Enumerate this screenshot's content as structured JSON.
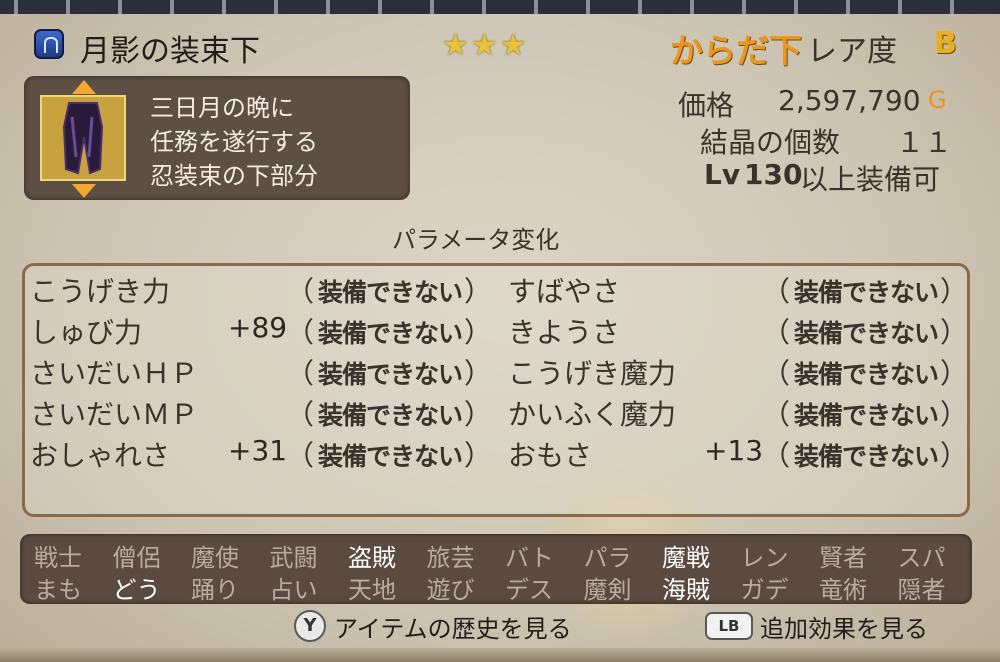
{
  "header": {
    "item_name": "月影の装束下",
    "stars": "★★★",
    "slot": "からだ下",
    "rarity_label": "レア度",
    "rarity": "B"
  },
  "description": [
    "三日月の晩に",
    "任務を遂行する",
    "忍装束の下部分"
  ],
  "stats_right": {
    "price_label": "価格",
    "price": "2,597,790",
    "price_unit": "G",
    "crystal_label": "結晶の個数",
    "crystal_count": "１１",
    "lv_prefix": "Lv",
    "lv_value": "130",
    "lv_suffix": "以上装備可"
  },
  "params_title": "パラメータ変化",
  "params_left": [
    {
      "label": "こうげき力",
      "value": "",
      "status": "装備できない"
    },
    {
      "label": "しゅび力",
      "value": "+89",
      "status": "装備できない"
    },
    {
      "label": "さいだいＨＰ",
      "value": "",
      "status": "装備できない"
    },
    {
      "label": "さいだいＭＰ",
      "value": "",
      "status": "装備できない"
    },
    {
      "label": "おしゃれさ",
      "value": "+31",
      "status": "装備できない"
    }
  ],
  "params_right": [
    {
      "label": "すばやさ",
      "value": "",
      "status": "装備できない"
    },
    {
      "label": "きようさ",
      "value": "",
      "status": "装備できない"
    },
    {
      "label": "こうげき魔力",
      "value": "",
      "status": "装備できない"
    },
    {
      "label": "かいふく魔力",
      "value": "",
      "status": "装備できない"
    },
    {
      "label": "おもさ",
      "value": "+13",
      "status": "装備できない"
    }
  ],
  "paren_open": "（",
  "paren_close": "）",
  "jobs_row1": [
    "戦士",
    "僧侶",
    "魔使",
    "武闘",
    "盗賊",
    "旅芸",
    "バト",
    "パラ",
    "魔戦",
    "レン",
    "賢者",
    "スパ"
  ],
  "jobs_row2": [
    "まも",
    "どう",
    "踊り",
    "占い",
    "天地",
    "遊び",
    "デス",
    "魔剣",
    "海賊",
    "ガデ",
    "竜術",
    "隠者"
  ],
  "jobs_row1_active": [
    false,
    false,
    false,
    false,
    true,
    false,
    false,
    false,
    true,
    false,
    false,
    false
  ],
  "jobs_row2_active": [
    false,
    true,
    false,
    false,
    false,
    false,
    false,
    false,
    true,
    false,
    false,
    false
  ],
  "footer": {
    "y_button": "Y",
    "history_label": "アイテムの歴史を見る",
    "lb_button": "LB",
    "extra_label": "追加効果を見る"
  },
  "colors": {
    "slot": "#e89820",
    "rarity": "#e8b020",
    "stars": "#e8c23c"
  }
}
